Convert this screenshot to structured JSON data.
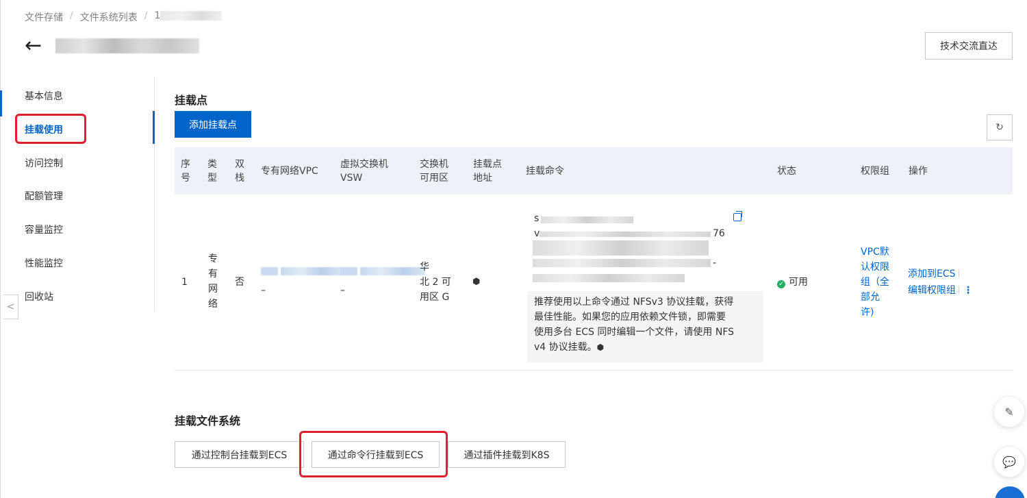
{
  "breadcrumb": {
    "items": [
      "文件存储",
      "文件系统列表",
      "1"
    ]
  },
  "header": {
    "back_icon": "←",
    "tech_button": "技术交流直达"
  },
  "sidebar": {
    "items": [
      {
        "label": "基本信息"
      },
      {
        "label": "挂载使用"
      },
      {
        "label": "访问控制"
      },
      {
        "label": "配额管理"
      },
      {
        "label": "容量监控"
      },
      {
        "label": "性能监控"
      },
      {
        "label": "回收站"
      }
    ],
    "collapse_icon": "<"
  },
  "mount_points": {
    "title": "挂载点",
    "add_button": "添加挂载点",
    "refresh_icon": "↻",
    "columns": {
      "index": [
        "序",
        "号"
      ],
      "type": [
        "类",
        "型"
      ],
      "dual": [
        "双",
        "栈"
      ],
      "vpc": "专有网络VPC",
      "vsw": [
        "虚拟交换机",
        "VSW"
      ],
      "zone": [
        "交换机",
        "可用区"
      ],
      "address": [
        "挂载点",
        "地址"
      ],
      "command": "挂载命令",
      "status": "状态",
      "permission": "权限组",
      "actions": "操作"
    },
    "row": {
      "index": "1",
      "type": [
        "专",
        "有",
        "网",
        "络"
      ],
      "dual": "否",
      "vpc_suffix": "–",
      "vsw_suffix": "–",
      "zone": [
        "华",
        "北 2 可",
        "用区 G"
      ],
      "address_icon": "⬢",
      "command_fragments": [
        "s",
        "v",
        "76",
        "-"
      ],
      "command_note": [
        "推荐使用以上命令通过 NFSv3 协议挂载，获得",
        "最佳性能。如果您的应用依赖文件锁，即需要",
        "使用多台 ECS 同时编辑一个文件，请使用 NFS",
        "v4 协议挂载。"
      ],
      "note_icon": "⬢",
      "status": "可用",
      "status_icon": "✓",
      "permission": [
        "VPC默",
        "认权限",
        "组（全",
        "部允",
        "许)"
      ],
      "action_add": "添加到ECS",
      "action_edit": "编辑权限组",
      "more_icon": "⋮"
    }
  },
  "mount_fs": {
    "title": "挂载文件系统",
    "tabs": [
      "通过控制台挂载到ECS",
      "通过命令行挂载到ECS",
      "通过插件挂载到K8S"
    ]
  },
  "floating": {
    "edit_icon": "✎",
    "feedback_icon": "💬"
  }
}
